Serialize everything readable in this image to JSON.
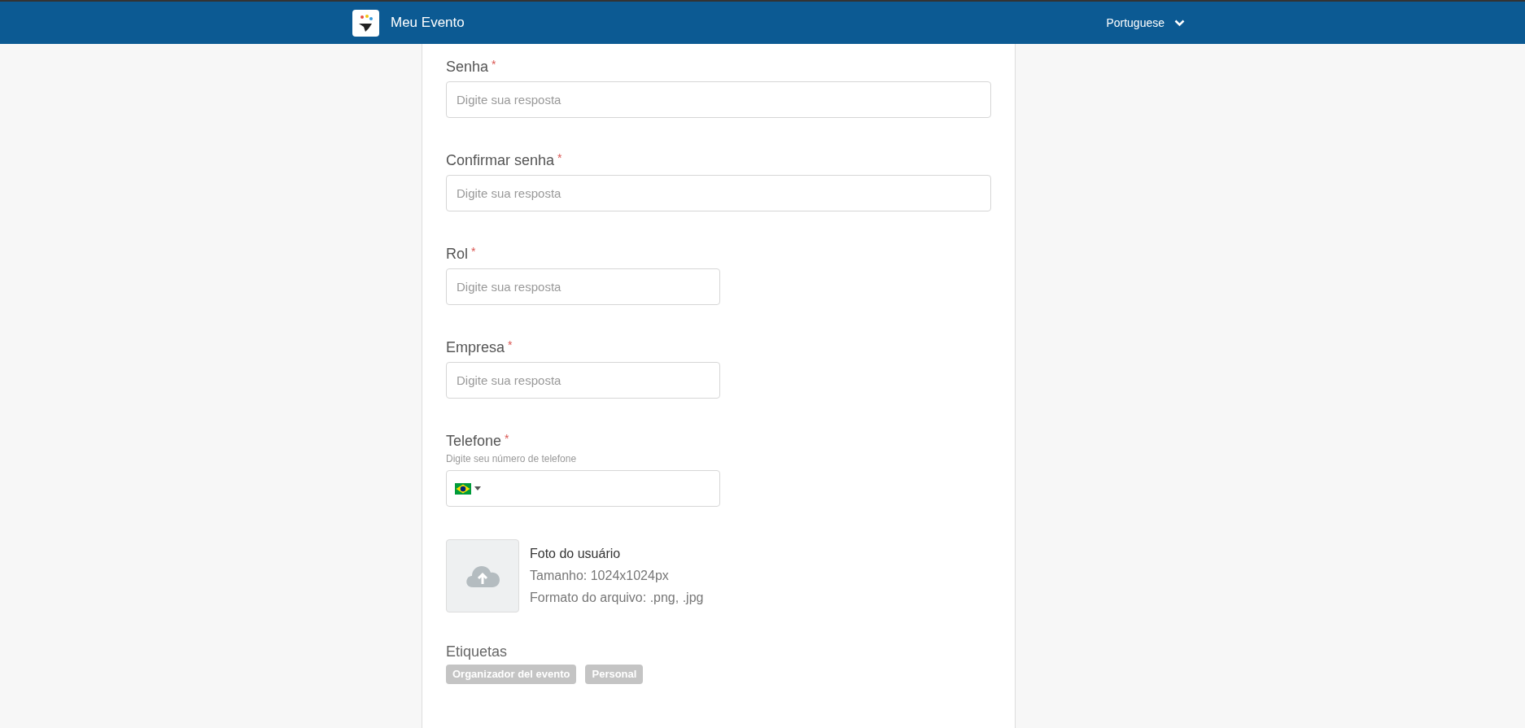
{
  "header": {
    "title": "Meu Evento",
    "language": "Portuguese"
  },
  "fields": [
    {
      "kind": "long_text",
      "label": "Senha",
      "required_mark": "*",
      "placeholder": "Digite sua resposta"
    },
    {
      "kind": "long_text",
      "label": "Confirmar senha",
      "required_mark": "*",
      "placeholder": "Digite sua resposta"
    },
    {
      "kind": "short_text",
      "label": "Rol",
      "required_mark": "*",
      "placeholder": "Digite sua resposta"
    },
    {
      "kind": "short_text",
      "label": "Empresa",
      "required_mark": "*",
      "placeholder": "Digite sua resposta"
    },
    {
      "kind": "phone",
      "label": "Telefone",
      "required_mark": "*",
      "hint": "Digite seu número de telefone"
    }
  ],
  "upload": {
    "title": "Foto do usuário",
    "size": "Tamanho: 1024x1024px",
    "format": "Formato do arquivo: .png, .jpg"
  },
  "tags": {
    "label": "Etiquetas",
    "items": [
      "Organizador del evento",
      "Personal"
    ]
  }
}
